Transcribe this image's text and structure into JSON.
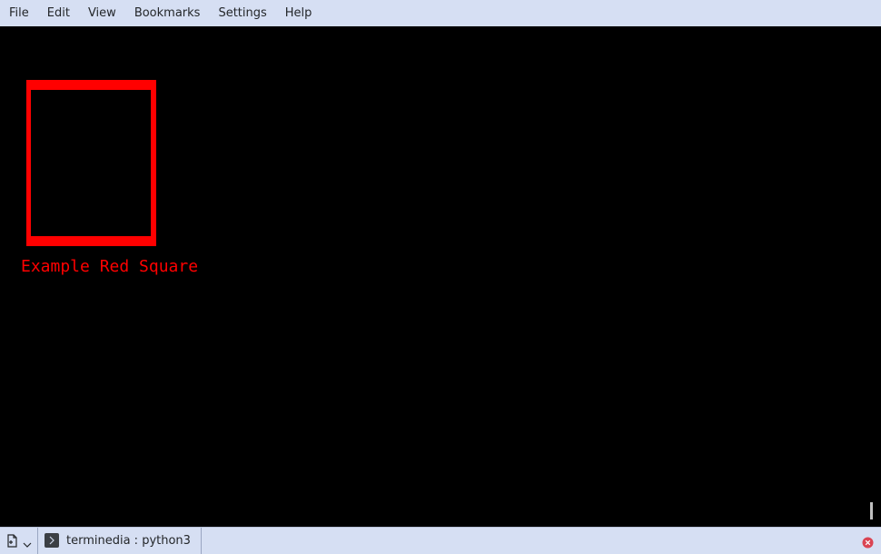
{
  "menubar": {
    "items": [
      "File",
      "Edit",
      "View",
      "Bookmarks",
      "Settings",
      "Help"
    ]
  },
  "terminal": {
    "square_label": "Example Red Square",
    "square_color": "#ff0000",
    "background": "#000000"
  },
  "tabbar": {
    "tabs": [
      {
        "label": "terminedia : python3",
        "icon": "terminal-icon"
      }
    ],
    "new_tab_icon": "new-tab-icon",
    "close_icon": "close-icon"
  },
  "colors": {
    "chrome": "#d6dff3",
    "text": "#232629",
    "close_red": "#da4453"
  }
}
